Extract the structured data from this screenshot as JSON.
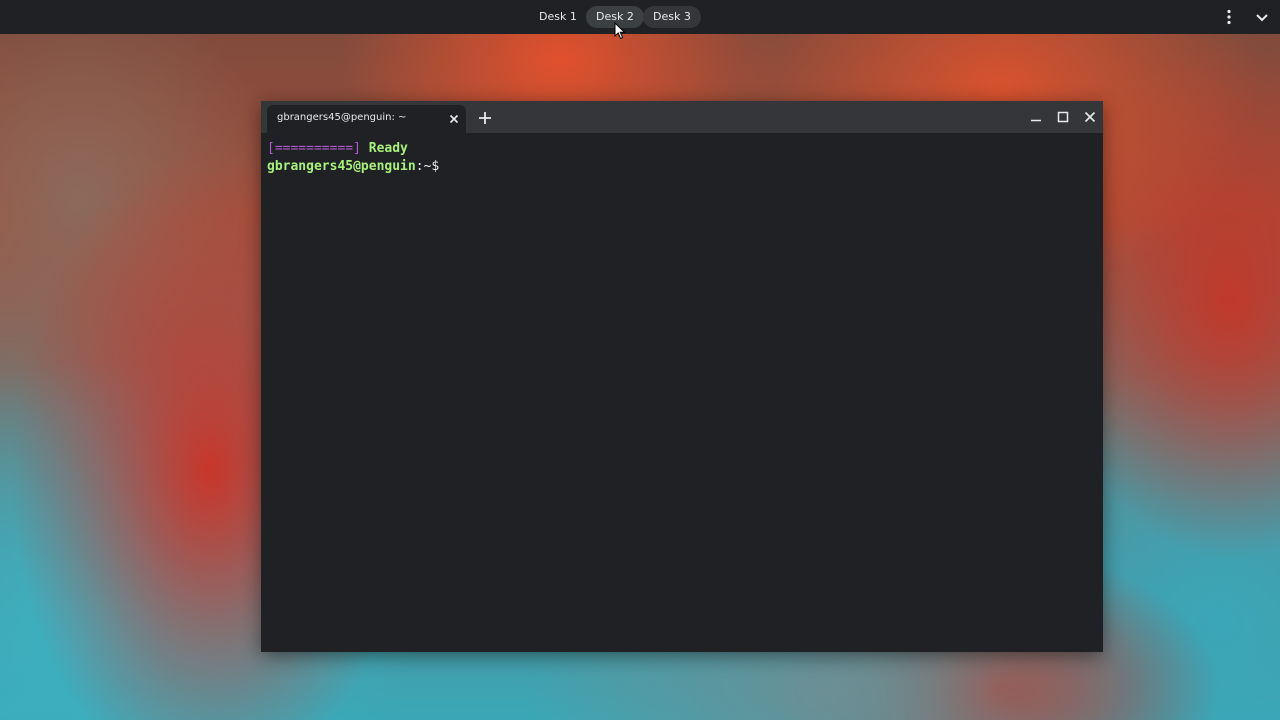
{
  "topbar": {
    "desks": [
      {
        "label": "Desk 1"
      },
      {
        "label": "Desk 2"
      },
      {
        "label": "Desk 3"
      }
    ],
    "icons": [
      "more-vert-icon",
      "chevron-down-icon"
    ]
  },
  "window": {
    "tab_title": "gbrangers45@penguin: ~",
    "controls": [
      "minimize-icon",
      "maximize-icon",
      "close-icon"
    ]
  },
  "terminal": {
    "progress_bar": "[==========]",
    "status": "Ready",
    "prompt_user": "gbrangers45@penguin",
    "prompt_path": ":~$"
  },
  "colors": {
    "topbar_bg": "#202124",
    "terminal_bg": "#202124",
    "prompt_green": "#a8f07d",
    "progress_purple": "#b05ad1"
  }
}
